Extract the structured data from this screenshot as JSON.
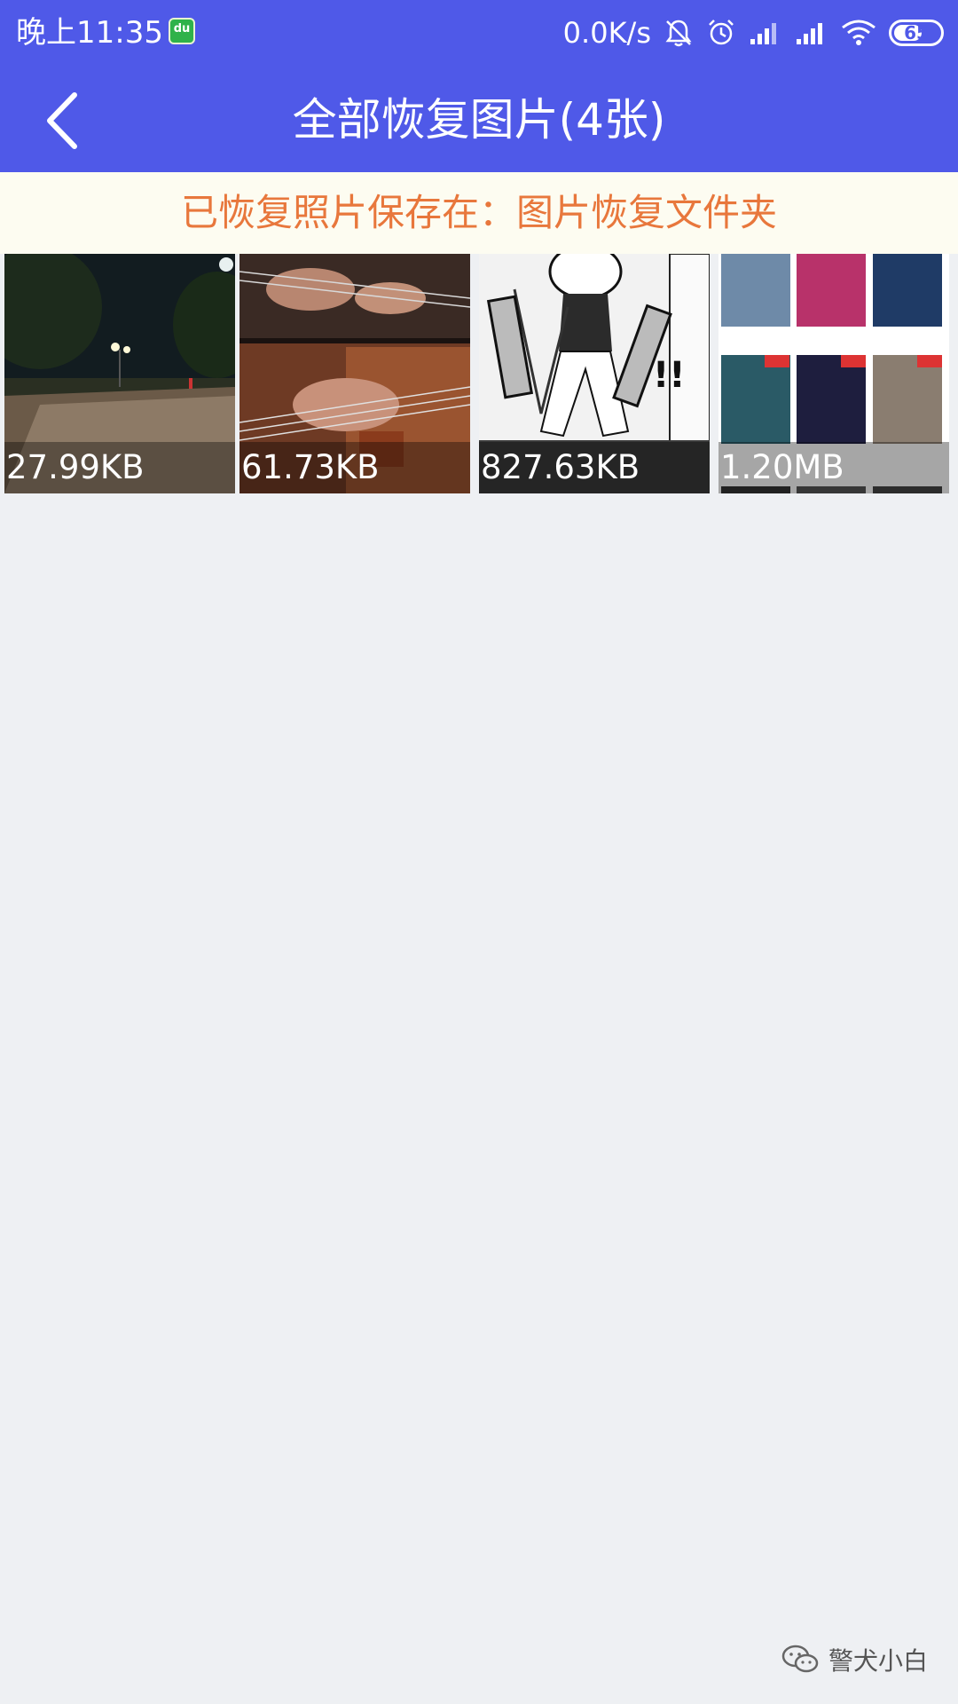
{
  "status_bar": {
    "time": "晚上11:35",
    "app_badge": "du",
    "network_speed": "0.0K/s",
    "battery": "65",
    "icons": [
      "mute-bell-icon",
      "alarm-icon",
      "signal-icon",
      "signal-icon",
      "wifi-icon",
      "battery-icon"
    ]
  },
  "header": {
    "title": "全部恢复图片(4张)",
    "back_icon": "chevron-left-icon",
    "color": "#4f59e8"
  },
  "notice": {
    "text": "已恢复照片保存在：图片恢复文件夹",
    "color": "#e8773c"
  },
  "thumbnails": [
    {
      "size": "27.99KB",
      "subject": "night street"
    },
    {
      "size": "61.73KB",
      "subject": "guitar"
    },
    {
      "size": "827.63KB",
      "subject": "manga page"
    },
    {
      "size": "1.20MB",
      "subject": "tv posters grid"
    }
  ],
  "watermark": {
    "text": "警犬小白",
    "icon": "wechat-icon"
  }
}
